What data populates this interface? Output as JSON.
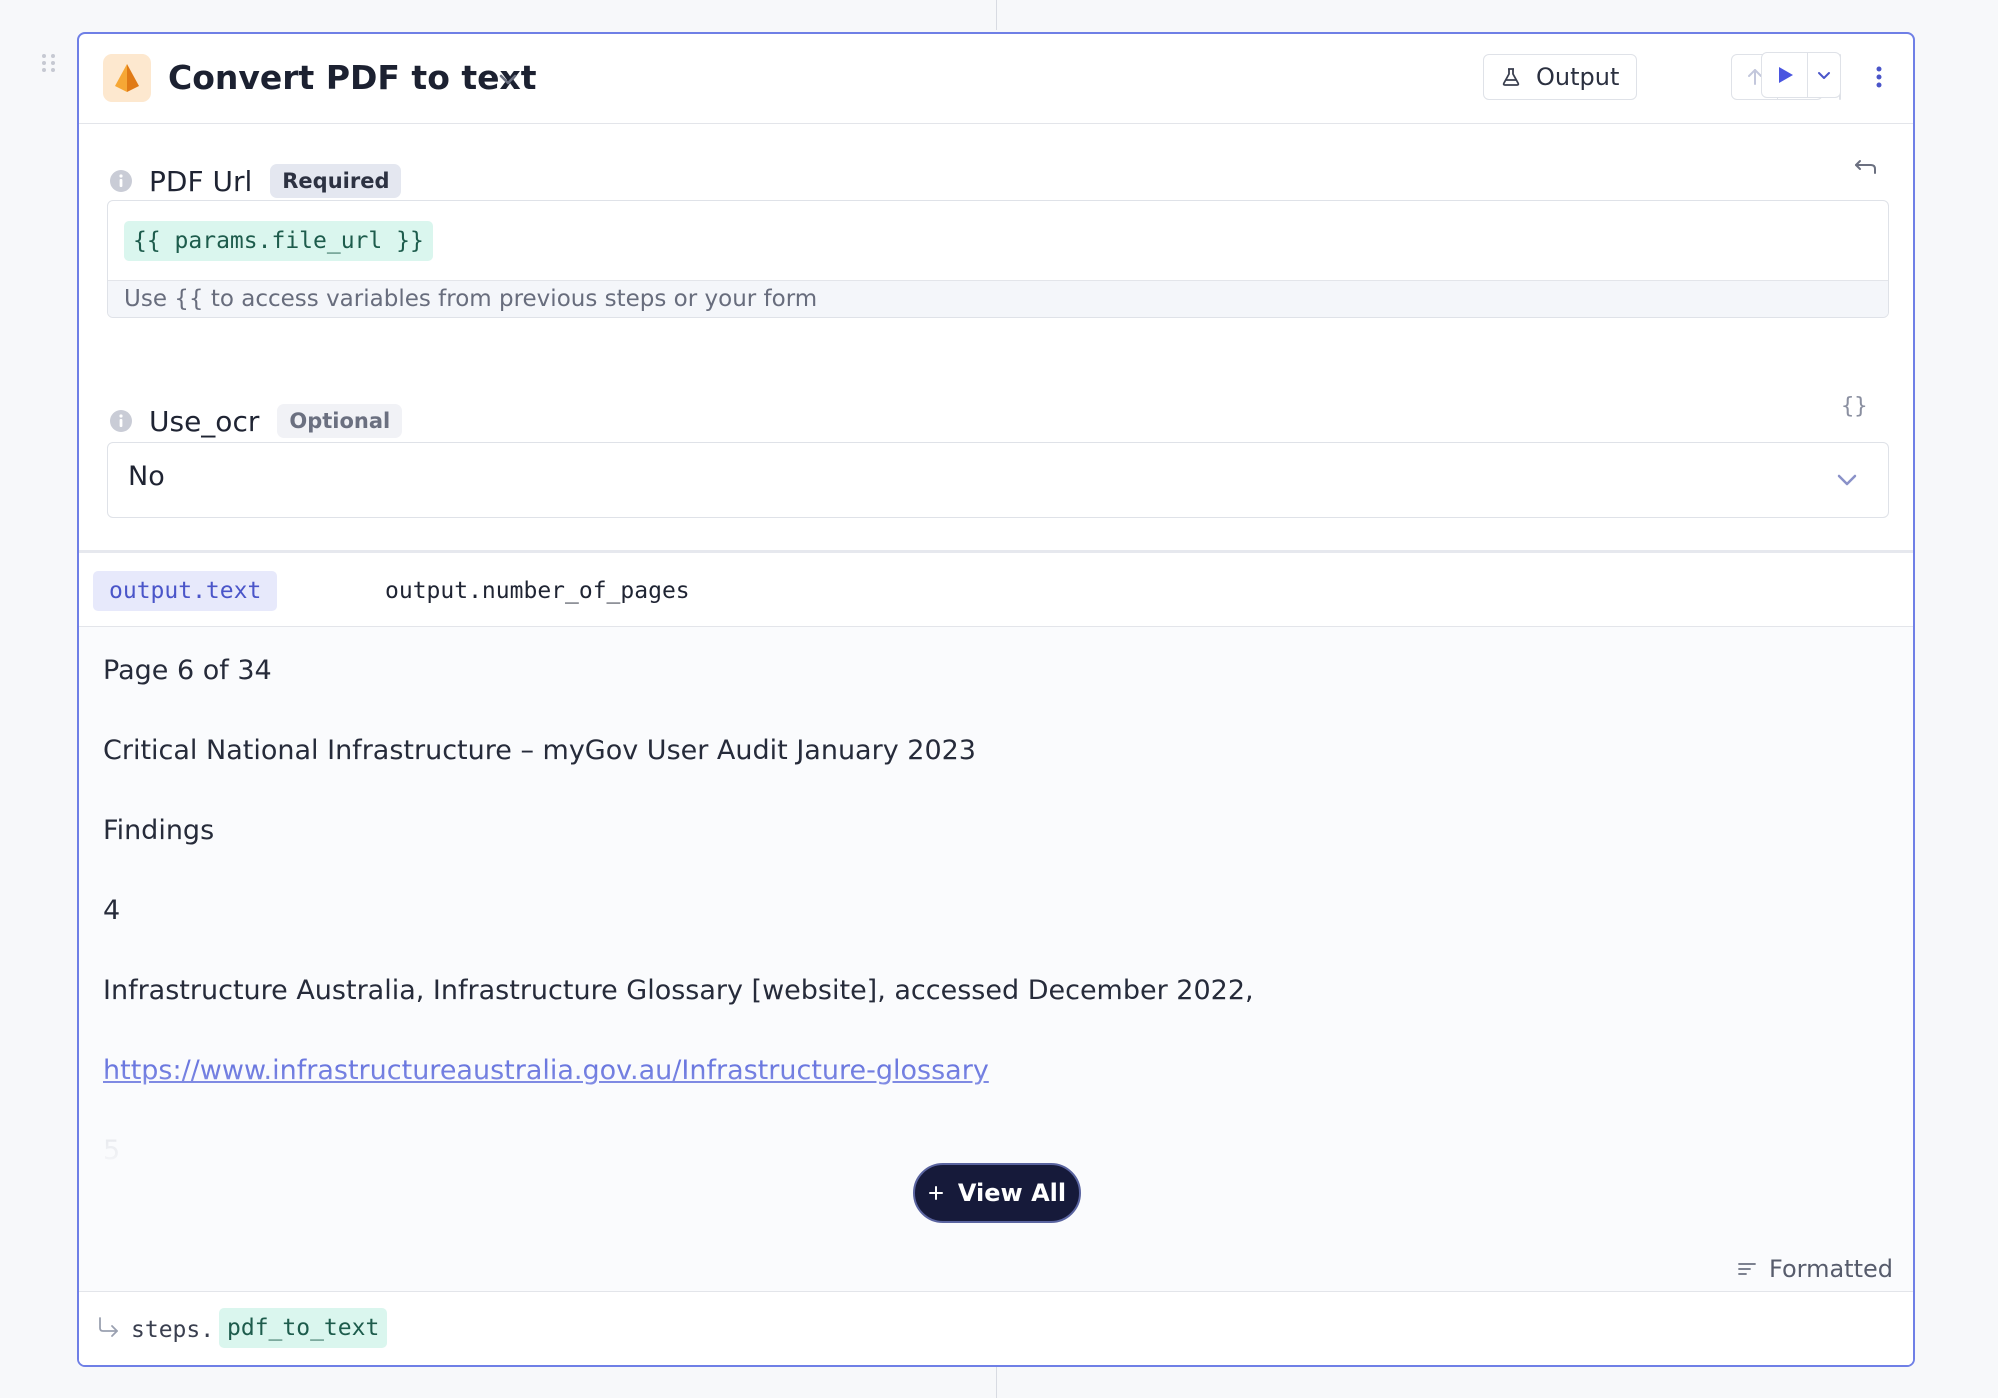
{
  "step": {
    "title": "Convert PDF to text",
    "output_button_label": "Output"
  },
  "fields": {
    "pdf_url": {
      "label": "PDF Url",
      "badge": "Required",
      "value": "{{ params.file_url }}",
      "hint": "Use {{ to access variables from previous steps or your form"
    },
    "use_ocr": {
      "label": "Use_ocr",
      "badge": "Optional",
      "json_toggle": "{}",
      "value": "No"
    }
  },
  "output": {
    "tabs": [
      "output.text",
      "output.number_of_pages"
    ],
    "active_tab": "output.text",
    "lines": [
      "Page 6 of 34",
      "Critical National Infrastructure – myGov User Audit January 2023",
      "Findings",
      "4",
      "Infrastructure Australia, Infrastructure Glossary [website], accessed December 2022,",
      "https://www.infrastructureaustralia.gov.au/Infrastructure-glossary",
      "5"
    ],
    "view_all_label": "View All",
    "format_label": "Formatted"
  },
  "footer": {
    "prefix": "steps.",
    "step_id": "pdf_to_text"
  },
  "colors": {
    "accent": "#6f7fe6",
    "variable_chip_bg": "#daf6ee",
    "view_all_bg": "#161a3a"
  }
}
